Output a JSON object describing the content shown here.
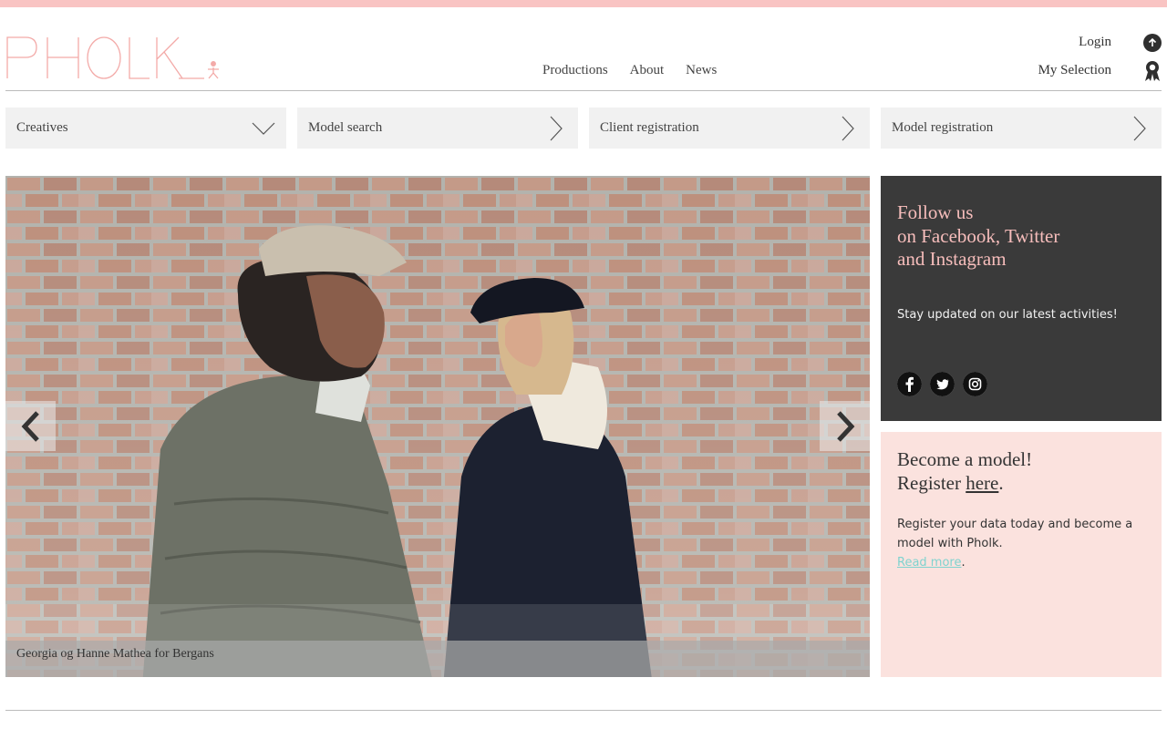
{
  "brand": {
    "logo_text": "PHOLK",
    "accent": "#f9c4c3",
    "dark_panel": "#3a3a3a",
    "pink_panel": "#fbe2de"
  },
  "header": {
    "login": "Login",
    "my_selection": "My Selection",
    "nav": [
      "Productions",
      "About",
      "News"
    ],
    "icons": {
      "up": "arrow-up-icon",
      "selection": "award-ribbon-icon"
    }
  },
  "tiles": [
    {
      "label": "Creatives",
      "icon": "chevron-down-icon"
    },
    {
      "label": "Model search",
      "icon": "chevron-right-icon"
    },
    {
      "label": "Client registration",
      "icon": "chevron-right-icon"
    },
    {
      "label": "Model registration",
      "icon": "chevron-right-icon"
    }
  ],
  "slider": {
    "caption": "Georgia og Hanne Mathea for Bergans",
    "prev_icon": "chevron-left-icon",
    "next_icon": "chevron-right-icon"
  },
  "follow": {
    "heading_lines": [
      "Follow us",
      "on Facebook, Twitter",
      "and Instagram"
    ],
    "text": "Stay updated on our latest activities!",
    "social_icons": [
      "facebook-icon",
      "twitter-icon",
      "instagram-icon"
    ]
  },
  "become": {
    "heading_line1": "Become a model!",
    "heading_prefix": "Register ",
    "heading_link": "here",
    "heading_suffix": ".",
    "text": "Register your data today and become a model with Pholk.",
    "read_more": "Read more",
    "read_more_suffix": "."
  }
}
